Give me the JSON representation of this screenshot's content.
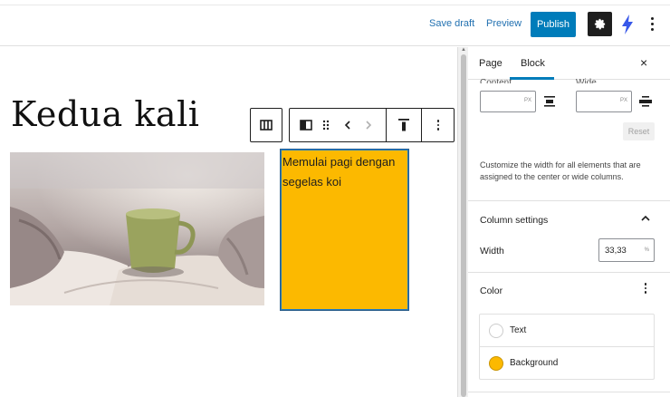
{
  "header": {
    "save_draft": "Save draft",
    "preview": "Preview",
    "publish": "Publish"
  },
  "editor": {
    "page_title": "Kedua kali",
    "column_text": "Memulai pagi dengan segelas koi",
    "add_block": "+"
  },
  "sidebar": {
    "tabs": [
      "Page",
      "Block"
    ],
    "active_tab": "Block",
    "close": "×",
    "layout": {
      "content_label": "Content",
      "wide_label": "Wide",
      "content_unit": "PX",
      "wide_unit": "PX",
      "reset": "Reset",
      "help": "Customize the width for all elements that are assigned to the center or wide columns."
    },
    "column_settings": {
      "title": "Column settings",
      "width_label": "Width",
      "width_value": "33,33",
      "width_unit": "%"
    },
    "color": {
      "title": "Color",
      "items": [
        {
          "label": "Text",
          "color": "#ffffff"
        },
        {
          "label": "Background",
          "color": "#fcb900"
        }
      ]
    }
  },
  "colors": {
    "accent": "#007cba",
    "column_background": "#fcb900",
    "dark": "#1e1e1e"
  }
}
